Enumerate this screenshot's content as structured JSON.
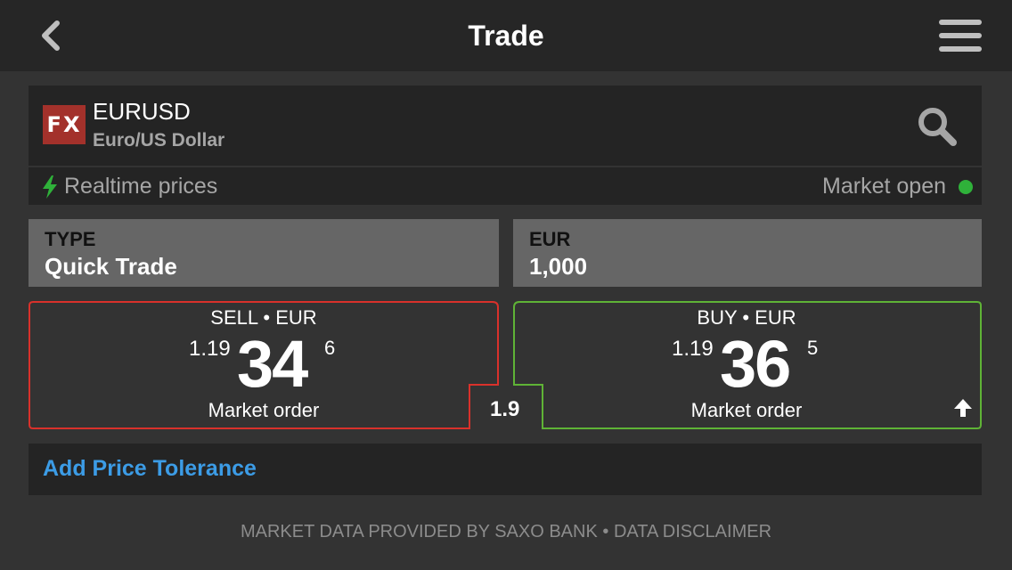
{
  "header": {
    "title": "Trade"
  },
  "instrument": {
    "badge": "FX",
    "symbol": "EURUSD",
    "description": "Euro/US Dollar"
  },
  "status": {
    "realtime_label": "Realtime prices",
    "market_label": "Market open",
    "market_status_color": "#2fb13a"
  },
  "fields": {
    "type": {
      "label": "TYPE",
      "value": "Quick Trade"
    },
    "amount": {
      "label": "EUR",
      "value": "1,000"
    }
  },
  "sell": {
    "heading": "SELL • EUR",
    "price_prefix": "1.19",
    "price_big": "34",
    "price_sup": "6",
    "order_type": "Market order",
    "border_color": "#d9312b"
  },
  "buy": {
    "heading": "BUY • EUR",
    "price_prefix": "1.19",
    "price_big": "36",
    "price_sup": "5",
    "order_type": "Market order",
    "border_color": "#5fb336",
    "trend_icon": "arrow-up-icon"
  },
  "spread": "1.9",
  "tolerance": {
    "label": "Add Price Tolerance",
    "color": "#3c9ce6"
  },
  "footer": {
    "provider": "MARKET DATA PROVIDED BY SAXO BANK",
    "separator": "•",
    "disclaimer": "DATA DISCLAIMER"
  }
}
